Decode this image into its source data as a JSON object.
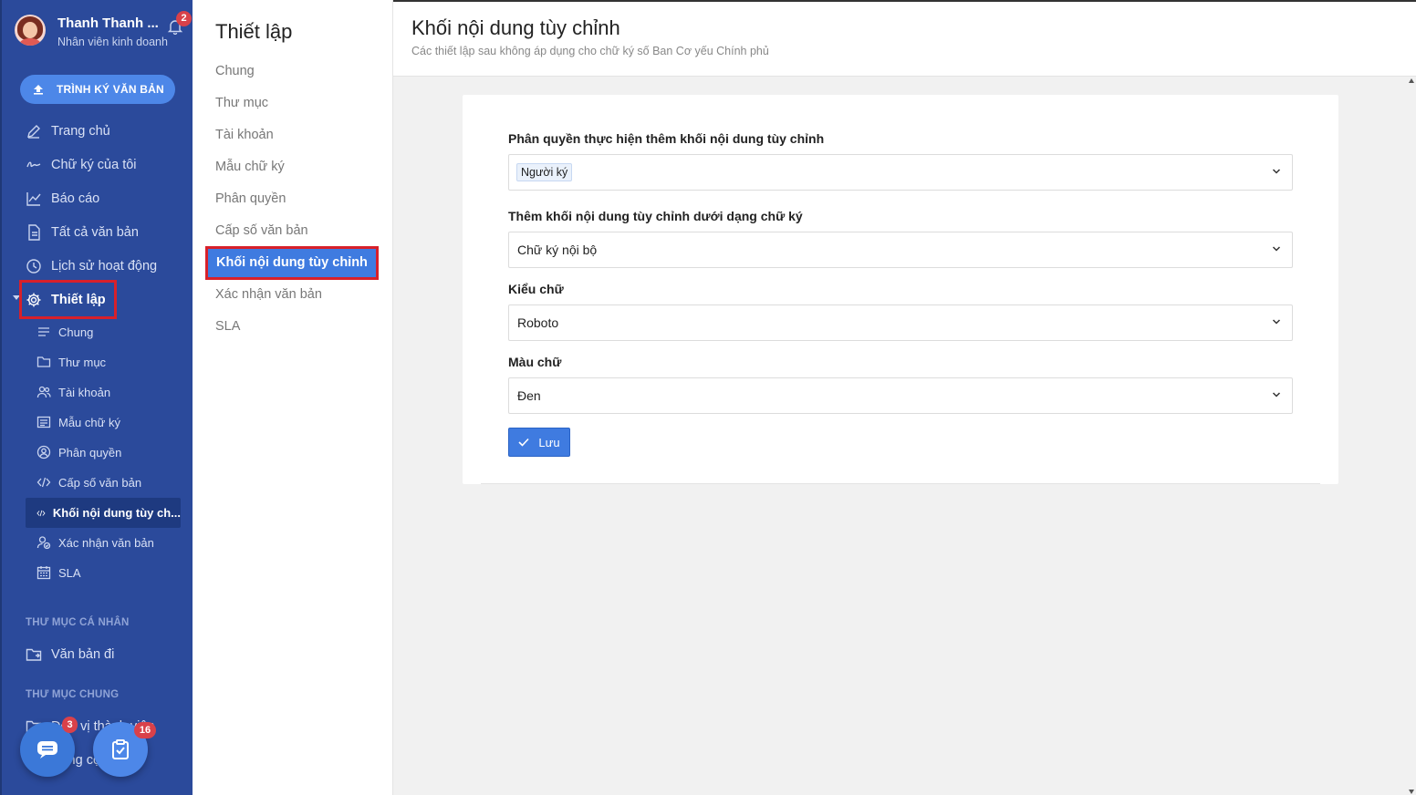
{
  "user": {
    "name": "Thanh Thanh ...",
    "role": "Nhân viên kinh doanh",
    "notifications": "2"
  },
  "sidebar": {
    "sign_button": "TRÌNH KÝ VĂN BẢN",
    "items": [
      {
        "label": "Trang chủ",
        "icon": "pen-icon"
      },
      {
        "label": "Chữ ký của tôi",
        "icon": "signature-icon"
      },
      {
        "label": "Báo cáo",
        "icon": "chart-icon"
      },
      {
        "label": "Tất cả văn bản",
        "icon": "document-icon"
      },
      {
        "label": "Lịch sử hoạt động",
        "icon": "clock-icon"
      },
      {
        "label": "Thiết lập",
        "icon": "gear-icon"
      }
    ],
    "sub_items": [
      {
        "label": "Chung",
        "icon": "lines-icon"
      },
      {
        "label": "Thư mục",
        "icon": "folder-icon"
      },
      {
        "label": "Tài khoản",
        "icon": "users-icon"
      },
      {
        "label": "Mẫu chữ ký",
        "icon": "template-icon"
      },
      {
        "label": "Phân quyền",
        "icon": "user-circle-icon"
      },
      {
        "label": "Cấp số văn bản",
        "icon": "code-icon"
      },
      {
        "label": "Khối nội dung tùy ch...",
        "icon": "code-icon"
      },
      {
        "label": "Xác nhận văn bản",
        "icon": "user-check-icon"
      },
      {
        "label": "SLA",
        "icon": "calendar-icon"
      }
    ],
    "personal_section": "THƯ MỤC CÁ NHÂN",
    "personal_item": "Văn bản đi",
    "shared_section": "THƯ MỤC CHUNG",
    "shared_item_1": "Đơn vị thành viên",
    "shared_item_2": "Công cộng",
    "chat_badge": "3",
    "task_badge": "16"
  },
  "settings_nav": {
    "title": "Thiết lập",
    "items": [
      "Chung",
      "Thư mục",
      "Tài khoản",
      "Mẫu chữ ký",
      "Phân quyền",
      "Cấp số văn bản",
      "Khối nội dung tùy chỉnh",
      "Xác nhận văn bản",
      "SLA"
    ]
  },
  "main": {
    "title": "Khối nội dung tùy chỉnh",
    "subtitle": "Các thiết lập sau không áp dụng cho chữ ký số Ban Cơ yếu Chính phủ",
    "fields": [
      {
        "label": "Phân quyền thực hiện thêm khối nội dung tùy chỉnh",
        "value": "Người ký"
      },
      {
        "label": "Thêm khối nội dung tùy chỉnh dưới dạng chữ ký",
        "value": "Chữ ký nội bộ"
      },
      {
        "label": "Kiểu chữ",
        "value": "Roboto"
      },
      {
        "label": "Màu chữ",
        "value": "Đen"
      }
    ],
    "save_label": "Lưu"
  }
}
